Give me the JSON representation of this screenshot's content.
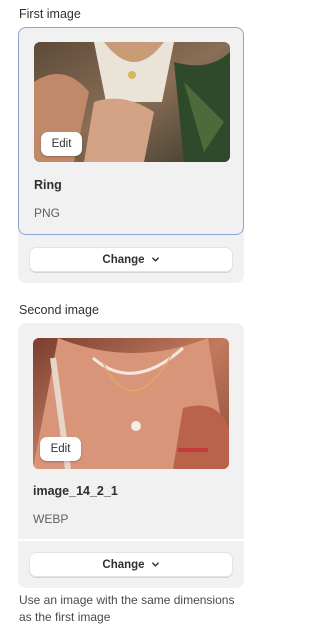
{
  "first": {
    "label": "First image",
    "edit_label": "Edit",
    "title": "Ring",
    "format": "PNG",
    "change_label": "Change"
  },
  "second": {
    "label": "Second image",
    "edit_label": "Edit",
    "title": "image_14_2_1",
    "format": "WEBP",
    "change_label": "Change"
  },
  "help_text": "Use an image with the same dimensions as the first image",
  "colors": {
    "selected_border": "#8aa6d6",
    "card_bg": "#f1f1f1"
  },
  "icons": {
    "chevron": "chevron-down-icon"
  }
}
